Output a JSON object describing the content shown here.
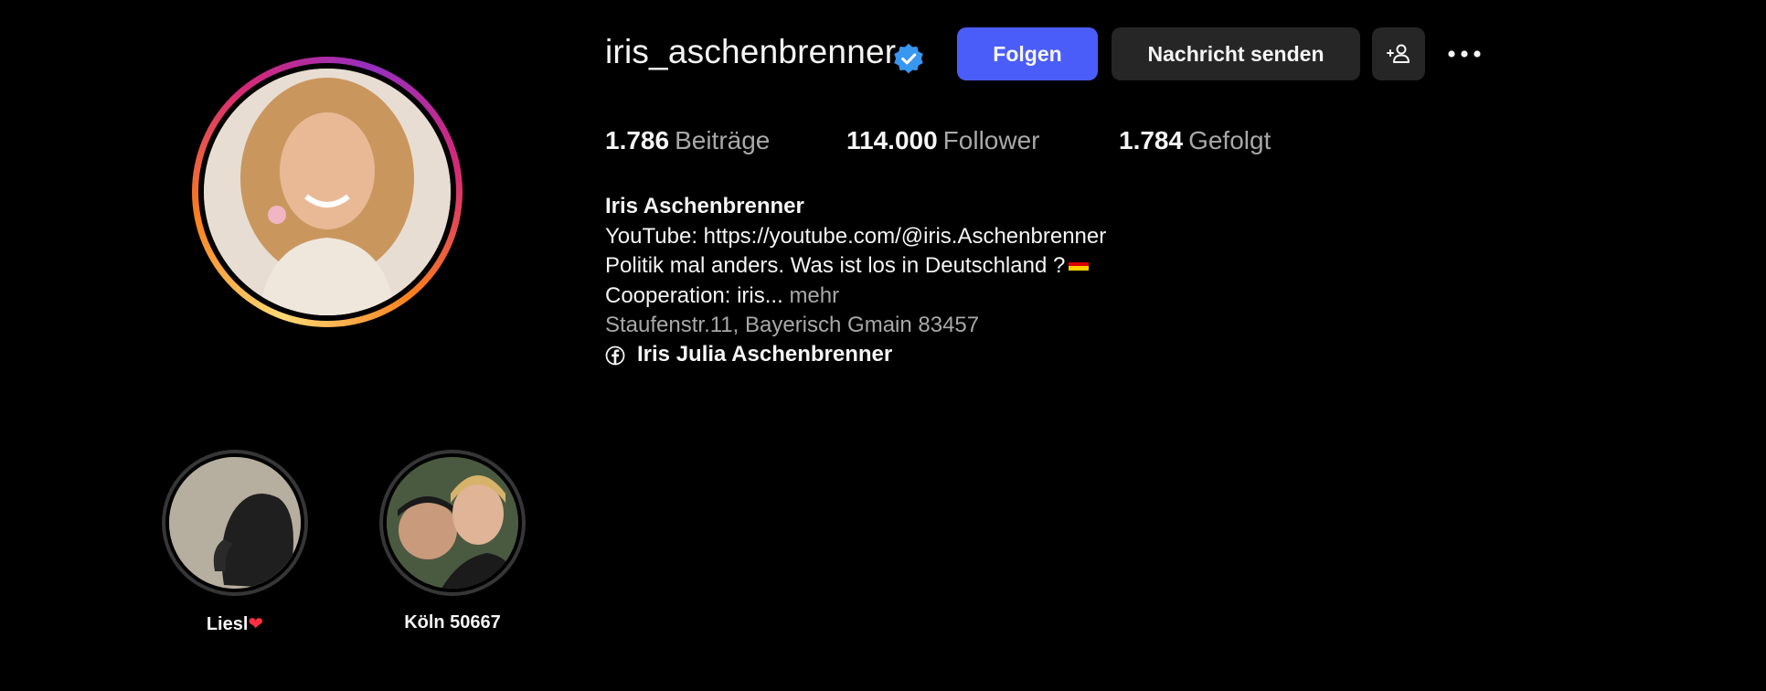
{
  "profile": {
    "username": "iris_aschenbrenner",
    "verified": true,
    "accent_color": "#4a5df9",
    "verified_color": "#3897f0"
  },
  "actions": {
    "follow_label": "Folgen",
    "message_label": "Nachricht senden",
    "suggest_icon": "add-person-icon",
    "more_icon": "more-horizontal-icon"
  },
  "stats": {
    "posts": {
      "value": "1.786",
      "label": "Beiträge"
    },
    "followers": {
      "value": "114.000",
      "label": "Follower"
    },
    "following": {
      "value": "1.784",
      "label": "Gefolgt"
    }
  },
  "bio": {
    "name": "Iris Aschenbrenner",
    "line1": "YouTube: https://youtube.com/@iris.Aschenbrenner",
    "line2": "Politik mal anders. Was ist los in Deutschland ?",
    "line3_text": "Cooperation: iris...",
    "line3_more": "mehr",
    "address": "Staufenstr.11, Bayerisch Gmain 83457",
    "facebook_link": "Iris Julia Aschenbrenner"
  },
  "highlights": [
    {
      "label": "Liesl"
    },
    {
      "label": "Köln 50667"
    }
  ]
}
